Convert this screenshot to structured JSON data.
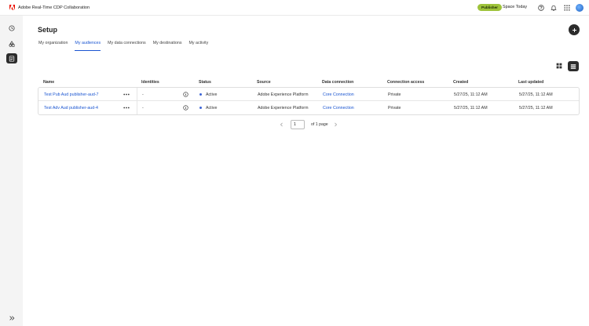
{
  "header": {
    "app_title": "Adobe Real-Time CDP Collaboration",
    "badge": "Publisher",
    "space": "Space Today",
    "icons": [
      "help-icon",
      "bell-icon",
      "apps-grid-icon",
      "avatar"
    ]
  },
  "sidebar": {
    "items": [
      {
        "name": "clock-icon"
      },
      {
        "name": "shapes-icon"
      },
      {
        "name": "setup-icon",
        "active": true
      }
    ],
    "expand_icon": "double-chevron-right-icon"
  },
  "page": {
    "title": "Setup",
    "tabs": [
      {
        "label": "My organization",
        "active": false
      },
      {
        "label": "My audiences",
        "active": true
      },
      {
        "label": "My data connections",
        "active": false
      },
      {
        "label": "My destinations",
        "active": false
      },
      {
        "label": "My activity",
        "active": false
      }
    ]
  },
  "table": {
    "columns": [
      "Name",
      "Identities",
      "Status",
      "Source",
      "Data connection",
      "Connection access",
      "Created",
      "Last updated"
    ],
    "rows": [
      {
        "name": "Test Pub Aud publisher-aud-7",
        "identities": "-",
        "status": "Active",
        "source": "Adobe Experience Platform",
        "connection": "Core Connection",
        "access": "Private",
        "created": "5/27/25, 11:12 AM",
        "updated": "5/27/25, 11:12 AM"
      },
      {
        "name": "Test Adv Aud publisher-aud-4",
        "identities": "-",
        "status": "Active",
        "source": "Adobe Experience Platform",
        "connection": "Core Connection",
        "access": "Private",
        "created": "5/27/25, 11:12 AM",
        "updated": "5/27/25, 11:12 AM"
      }
    ]
  },
  "pagination": {
    "page": "1",
    "label": "of 1 page"
  },
  "colors": {
    "accent": "#1a55d1",
    "badge": "#9ec33a",
    "status_active": "#3b63d6",
    "dark": "#2c2c2c"
  }
}
